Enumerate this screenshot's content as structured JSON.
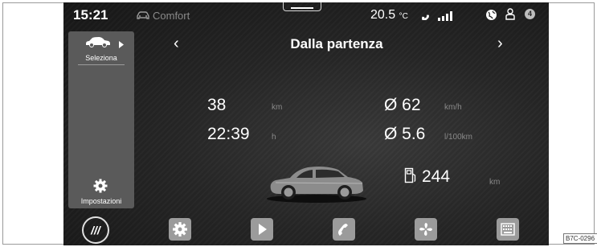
{
  "status": {
    "time": "15:21",
    "mode": "Comfort",
    "temperature": "20.5",
    "temperature_unit": "°C",
    "notification_count": "4"
  },
  "sidebar": {
    "select_label": "Seleziona",
    "settings_label": "Impostazioni"
  },
  "header": {
    "title": "Dalla partenza",
    "prev_arrow": "‹",
    "next_arrow": "›"
  },
  "stats": {
    "distance_value": "38",
    "distance_unit": "km",
    "time_value": "22:39",
    "time_unit": "h",
    "avg_speed_value": "Ø 62",
    "avg_speed_unit": "km/h",
    "avg_consumption_value": "Ø 5.6",
    "avg_consumption_unit": "l/100km",
    "range_value": "244",
    "range_unit": "km"
  },
  "bottom_bar": {
    "menu_label": "///",
    "apps": [
      "gear-icon",
      "play-icon",
      "phone-icon",
      "fan-icon",
      "keyboard-icon"
    ]
  },
  "figure_code": "B7C-0296",
  "colors": {
    "background": "#1f1f1f",
    "sidebar": "#5a5a5a",
    "text": "#ffffff",
    "unit_text": "#8a8a8a",
    "app_button": "#9b9b9b"
  }
}
